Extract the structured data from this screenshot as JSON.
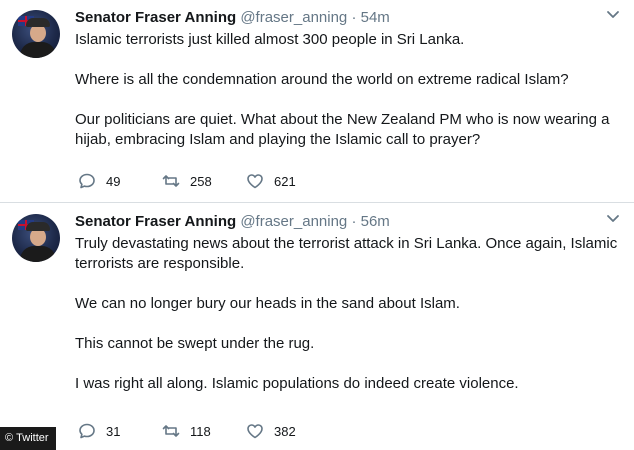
{
  "tweets": [
    {
      "author_name": "Senator Fraser Anning",
      "handle": "@fraser_anning",
      "separator": "·",
      "time": "54m",
      "lines": [
        "Islamic terrorists just killed almost 300 people in Sri Lanka.",
        "Where is all the condemnation around the world on extreme radical Islam?",
        "Our politicians are quiet. What about the New Zealand PM who is now wearing a",
        "hijab, embracing Islam and playing the Islamic call to prayer?"
      ],
      "replies": "49",
      "retweets": "258",
      "likes": "621"
    },
    {
      "author_name": "Senator Fraser Anning",
      "handle": "@fraser_anning",
      "separator": "·",
      "time": "56m",
      "lines": [
        "Truly devastating news about the terrorist attack in Sri Lanka. Once again, Islamic",
        "terrorists are responsible.",
        "We can no longer bury our heads in the sand about Islam.",
        "This cannot be swept under the rug.",
        "I was right all along. Islamic populations do indeed create violence."
      ],
      "replies": "31",
      "retweets": "118",
      "likes": "382"
    }
  ],
  "watermark": {
    "copyright": "©",
    "source": "Twitter"
  },
  "icons": [
    "reply-icon",
    "retweet-icon",
    "like-icon",
    "caret-down-icon"
  ]
}
